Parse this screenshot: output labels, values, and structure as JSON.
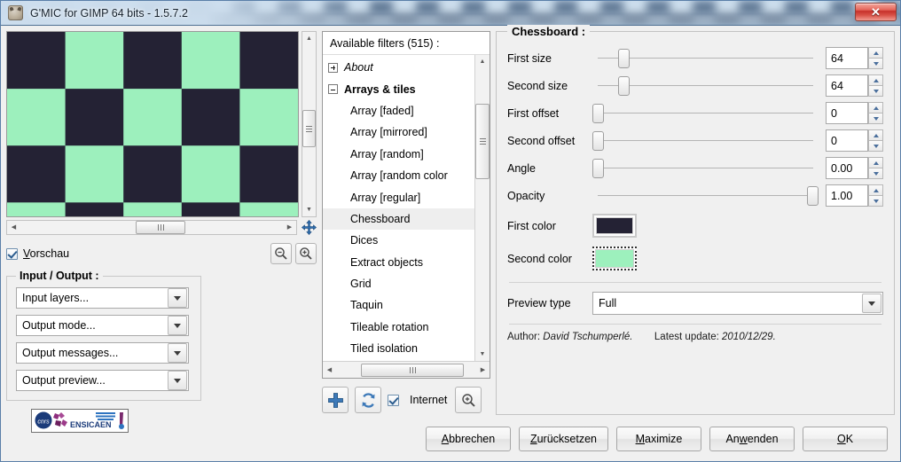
{
  "window": {
    "title": "G'MIC for GIMP 64 bits - 1.5.7.2",
    "close_label": "✕",
    "app_icon": "gimp-wilber-icon"
  },
  "preview": {
    "checkbox_label_before": "V",
    "checkbox_label_rest": "orschau",
    "checked": true,
    "zoom_out_icon": "zoom-out-icon",
    "zoom_in_icon": "zoom-in-icon",
    "move_icon": "move-cross-icon",
    "colors": {
      "dark": "#242234",
      "light": "#9df0bd"
    },
    "columns": 5,
    "rows": 3.25
  },
  "input_output": {
    "title": "Input / Output :",
    "combos": [
      {
        "label": "Input layers...",
        "name": "input-layers-combo"
      },
      {
        "label": "Output mode...",
        "name": "output-mode-combo"
      },
      {
        "label": "Output messages...",
        "name": "output-messages-combo"
      },
      {
        "label": "Output preview...",
        "name": "output-preview-combo"
      }
    ],
    "logo_text": "ENSICAEN"
  },
  "filters": {
    "header": "Available filters (515) :",
    "items": [
      {
        "label": "About",
        "type": "group",
        "expanded": false,
        "style": "italic"
      },
      {
        "label": "Arrays & tiles",
        "type": "group",
        "expanded": true,
        "style": "bold"
      },
      {
        "label": "Array [faded]",
        "type": "child"
      },
      {
        "label": "Array [mirrored]",
        "type": "child"
      },
      {
        "label": "Array [random]",
        "type": "child"
      },
      {
        "label": "Array [random color",
        "type": "child"
      },
      {
        "label": "Array [regular]",
        "type": "child"
      },
      {
        "label": "Chessboard",
        "type": "child",
        "selected": true
      },
      {
        "label": "Dices",
        "type": "child"
      },
      {
        "label": "Extract objects",
        "type": "child"
      },
      {
        "label": "Grid",
        "type": "child"
      },
      {
        "label": "Taquin",
        "type": "child"
      },
      {
        "label": "Tileable rotation",
        "type": "child"
      },
      {
        "label": "Tiled isolation",
        "type": "child"
      }
    ],
    "toolbar": {
      "add_icon": "plus-icon",
      "refresh_icon": "refresh-icon",
      "internet_label": "Internet",
      "internet_checked": true,
      "zoom_icon": "zoom-in-icon"
    }
  },
  "params": {
    "title": "Chessboard :",
    "rows": [
      {
        "label": "First size",
        "value": "64",
        "slider_pct": 12,
        "name": "first-size"
      },
      {
        "label": "Second size",
        "value": "64",
        "slider_pct": 12,
        "name": "second-size"
      },
      {
        "label": "First offset",
        "value": "0",
        "slider_pct": 0,
        "name": "first-offset"
      },
      {
        "label": "Second offset",
        "value": "0",
        "slider_pct": 0,
        "name": "second-offset"
      },
      {
        "label": "Angle",
        "value": "0.00",
        "slider_pct": 0,
        "name": "angle"
      },
      {
        "label": "Opacity",
        "value": "1.00",
        "slider_pct": 100,
        "name": "opacity"
      }
    ],
    "first_color": {
      "label": "First color",
      "hex": "#242234"
    },
    "second_color": {
      "label": "Second color",
      "hex": "#9df0bd"
    },
    "preview_type": {
      "label": "Preview type",
      "value": "Full"
    },
    "author_prefix": "Author:",
    "author_name": "David Tschumperlé.",
    "update_prefix": "Latest update:",
    "update_date": "2010/12/29."
  },
  "footer": {
    "buttons": [
      {
        "accel": "A",
        "rest": "bbrechen",
        "name": "cancel-button"
      },
      {
        "accel": "Z",
        "rest": "urücksetzen",
        "name": "reset-button"
      },
      {
        "accel": "M",
        "rest": "aximize",
        "name": "maximize-button"
      },
      {
        "accel": "w",
        "rest": "enden",
        "pre": "An",
        "name": "apply-button"
      },
      {
        "accel": "O",
        "rest": "K",
        "name": "ok-button"
      }
    ]
  }
}
